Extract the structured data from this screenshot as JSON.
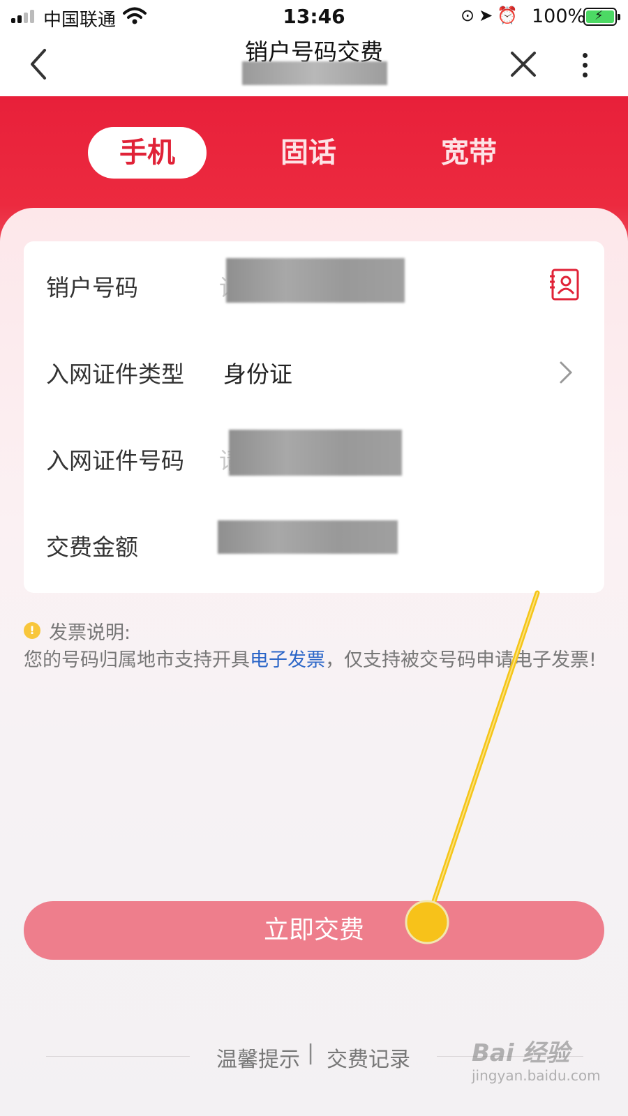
{
  "status_bar": {
    "carrier": "中国联通",
    "time": "13:46",
    "battery": "100%"
  },
  "nav": {
    "title": "销户号码交费"
  },
  "tabs": [
    {
      "label": "手机",
      "active": true
    },
    {
      "label": "固话",
      "active": false
    },
    {
      "label": "宽带",
      "active": false
    }
  ],
  "form": {
    "rows": [
      {
        "label": "销户号码",
        "placeholder_peek": "请"
      },
      {
        "label": "入网证件类型",
        "value": "身份证"
      },
      {
        "label": "入网证件号码",
        "placeholder_peek": "请"
      },
      {
        "label": "交费金额"
      }
    ]
  },
  "invoice_note": {
    "heading": "发票说明:",
    "text_before": "您的号码归属地市支持开具",
    "link": "电子发票",
    "text_after": "，仅支持被交号码申请电子发票!"
  },
  "pay_button": "立即交费",
  "footer": {
    "tips": "温馨提示",
    "separator": "|",
    "records": "交费记录"
  },
  "watermark": {
    "main": "Bai 经验",
    "sub": "jingyan.baidu.com"
  },
  "colors": {
    "brand_red": "#e8203a",
    "pay_button": "#ee7e8c",
    "link_blue": "#2b66c8",
    "annotation_yellow": "#f5c518"
  },
  "icons": [
    "signal-icon",
    "wifi-icon",
    "lock-rotation-icon",
    "location-icon",
    "alarm-icon",
    "battery-icon",
    "back-icon",
    "close-icon",
    "more-icon",
    "contacts-icon",
    "chevron-right-icon",
    "info-icon"
  ]
}
